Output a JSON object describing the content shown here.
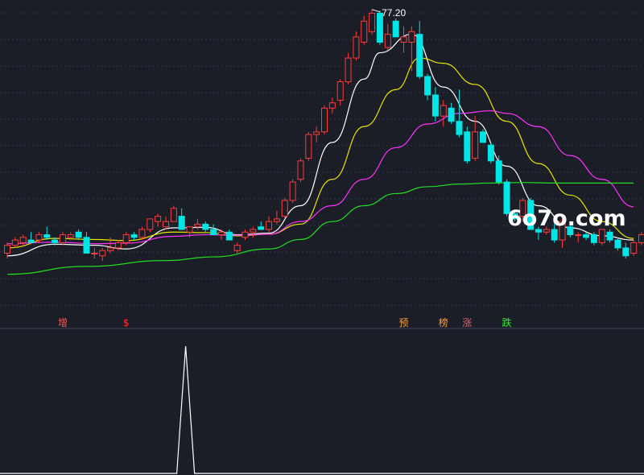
{
  "chart_data": {
    "type": "candlestick",
    "title": "",
    "xlabel": "",
    "ylabel": "",
    "ylim": [
      21,
      79
    ],
    "peak_label": "77.20",
    "watermark": "6o7o.com",
    "colors": {
      "up": "#ff3b3b",
      "down": "#00e5e5",
      "ma5": "#ffffff",
      "ma10": "#e6e600",
      "ma20": "#ff33ff",
      "ma60": "#22dd22",
      "grid": "#2a3552",
      "indicator": "#ffffff"
    },
    "candles": [
      [
        31.0,
        33.0,
        30.0,
        32.5
      ],
      [
        32.5,
        34.0,
        32.0,
        33.5
      ],
      [
        33.0,
        34.5,
        32.5,
        34.0
      ],
      [
        33.5,
        35.0,
        33.0,
        33.0
      ],
      [
        33.5,
        35.0,
        33.0,
        34.5
      ],
      [
        34.5,
        36.0,
        33.5,
        34.0
      ],
      [
        33.5,
        34.0,
        32.5,
        33.0
      ],
      [
        33.0,
        35.0,
        32.5,
        34.5
      ],
      [
        34.0,
        35.0,
        33.5,
        34.5
      ],
      [
        35.0,
        35.5,
        33.5,
        34.0
      ],
      [
        34.0,
        35.0,
        31.0,
        31.0
      ],
      [
        31.0,
        32.0,
        30.0,
        31.0
      ],
      [
        30.5,
        32.0,
        29.5,
        31.5
      ],
      [
        31.5,
        34.0,
        31.0,
        32.0
      ],
      [
        32.0,
        33.5,
        31.5,
        33.0
      ],
      [
        33.0,
        35.0,
        32.5,
        34.5
      ],
      [
        34.5,
        35.0,
        33.5,
        34.0
      ],
      [
        34.0,
        36.0,
        33.5,
        35.5
      ],
      [
        35.5,
        37.0,
        35.0,
        37.5
      ],
      [
        37.0,
        38.5,
        36.0,
        38.0
      ],
      [
        36.0,
        38.0,
        35.5,
        37.0
      ],
      [
        37.0,
        40.0,
        37.0,
        39.5
      ],
      [
        38.0,
        39.5,
        37.0,
        35.5
      ],
      [
        35.0,
        36.0,
        34.0,
        36.0
      ],
      [
        36.0,
        37.5,
        35.5,
        36.5
      ],
      [
        36.5,
        37.0,
        35.0,
        35.5
      ],
      [
        35.5,
        36.5,
        34.5,
        34.5
      ],
      [
        34.5,
        35.5,
        33.5,
        35.0
      ],
      [
        35.0,
        35.5,
        33.5,
        33.5
      ],
      [
        31.5,
        33.0,
        31.0,
        32.5
      ],
      [
        34.0,
        35.5,
        33.5,
        35.0
      ],
      [
        35.0,
        36.0,
        34.0,
        35.5
      ],
      [
        36.0,
        37.0,
        35.5,
        35.5
      ],
      [
        35.5,
        38.0,
        35.0,
        37.0
      ],
      [
        37.0,
        39.0,
        36.5,
        37.5
      ],
      [
        38.0,
        41.5,
        37.5,
        41.0
      ],
      [
        41.0,
        45.0,
        40.5,
        44.5
      ],
      [
        45.0,
        49.0,
        44.5,
        48.5
      ],
      [
        49.0,
        54.0,
        48.5,
        53.5
      ],
      [
        53.5,
        55.0,
        52.0,
        54.0
      ],
      [
        54.0,
        59.0,
        53.5,
        58.5
      ],
      [
        58.5,
        60.5,
        57.5,
        59.5
      ],
      [
        60.0,
        64.0,
        59.0,
        63.5
      ],
      [
        63.5,
        69.0,
        63.0,
        68.0
      ],
      [
        68.0,
        73.0,
        67.5,
        72.0
      ],
      [
        71.0,
        76.0,
        70.5,
        75.0
      ],
      [
        73.0,
        77.2,
        72.5,
        76.5
      ],
      [
        76.5,
        77.0,
        70.5,
        71.0
      ],
      [
        70.0,
        74.5,
        69.5,
        72.5
      ],
      [
        75.0,
        75.5,
        72.0,
        72.0
      ],
      [
        71.0,
        74.0,
        69.0,
        72.0
      ],
      [
        71.0,
        74.0,
        65.5,
        73.0
      ],
      [
        72.5,
        75.0,
        64.0,
        64.5
      ],
      [
        64.5,
        65.0,
        60.0,
        61.0
      ],
      [
        61.0,
        62.5,
        56.0,
        57.0
      ],
      [
        57.0,
        60.0,
        55.0,
        59.0
      ],
      [
        58.5,
        59.5,
        55.5,
        56.0
      ],
      [
        56.0,
        62.0,
        53.0,
        53.5
      ],
      [
        54.0,
        55.0,
        48.0,
        48.5
      ],
      [
        49.0,
        57.0,
        48.5,
        54.0
      ],
      [
        54.0,
        54.5,
        52.0,
        52.0
      ],
      [
        51.5,
        52.0,
        48.0,
        48.5
      ],
      [
        48.5,
        49.5,
        44.0,
        44.5
      ],
      [
        44.5,
        45.0,
        38.0,
        38.5
      ],
      [
        38.5,
        39.0,
        37.0,
        37.5
      ],
      [
        38.0,
        41.5,
        37.0,
        41.0
      ],
      [
        41.0,
        41.5,
        35.5,
        35.5
      ],
      [
        35.5,
        36.0,
        33.5,
        35.0
      ],
      [
        35.0,
        36.0,
        34.5,
        35.5
      ],
      [
        35.5,
        36.5,
        33.0,
        33.5
      ],
      [
        33.5,
        37.5,
        32.0,
        37.0
      ],
      [
        36.0,
        36.5,
        34.0,
        34.5
      ],
      [
        34.5,
        35.0,
        33.0,
        34.5
      ],
      [
        34.5,
        35.0,
        33.5,
        34.0
      ],
      [
        34.5,
        35.0,
        32.5,
        33.0
      ],
      [
        33.0,
        35.0,
        32.5,
        35.5
      ],
      [
        35.0,
        35.5,
        33.0,
        33.5
      ],
      [
        33.5,
        34.0,
        31.5,
        32.0
      ],
      [
        32.0,
        33.0,
        30.0,
        30.5
      ],
      [
        31.0,
        33.5,
        30.5,
        33.0
      ],
      [
        33.0,
        35.0,
        32.5,
        34.5
      ]
    ],
    "ma": [
      {
        "key": "ma5",
        "points": [
          [
            0,
            30.5
          ],
          [
            6,
            32.7
          ],
          [
            11,
            32.5
          ],
          [
            15,
            31.8
          ],
          [
            21,
            35.8
          ],
          [
            25,
            35.9
          ],
          [
            29,
            34.5
          ],
          [
            33,
            34.8
          ],
          [
            37,
            40
          ],
          [
            41,
            52
          ],
          [
            45,
            64
          ],
          [
            47,
            69
          ],
          [
            51,
            72.5
          ],
          [
            55,
            62.5
          ],
          [
            59,
            56
          ],
          [
            63,
            47.5
          ],
          [
            67,
            40
          ],
          [
            71,
            35.8
          ],
          [
            75,
            34.3
          ],
          [
            79,
            33.5
          ]
        ]
      },
      {
        "key": "ma10",
        "points": [
          [
            0,
            32.0
          ],
          [
            6,
            33.8
          ],
          [
            11,
            33.6
          ],
          [
            15,
            33.4
          ],
          [
            21,
            35.0
          ],
          [
            25,
            34.9
          ],
          [
            29,
            34.3
          ],
          [
            33,
            34.6
          ],
          [
            37,
            36.5
          ],
          [
            41,
            45
          ],
          [
            45,
            55
          ],
          [
            49,
            62
          ],
          [
            52,
            68
          ],
          [
            55,
            67
          ],
          [
            59,
            63
          ],
          [
            63,
            56
          ],
          [
            67,
            48
          ],
          [
            71,
            42
          ],
          [
            75,
            37
          ],
          [
            79,
            33.8
          ]
        ]
      },
      {
        "key": "ma20",
        "points": [
          [
            0,
            32.8
          ],
          [
            6,
            33.1
          ],
          [
            11,
            32.8
          ],
          [
            15,
            32.9
          ],
          [
            21,
            34.2
          ],
          [
            25,
            34.5
          ],
          [
            29,
            34.4
          ],
          [
            33,
            34.6
          ],
          [
            37,
            37
          ],
          [
            41,
            40
          ],
          [
            45,
            45
          ],
          [
            49,
            51
          ],
          [
            53,
            55.5
          ],
          [
            57,
            57.5
          ],
          [
            61,
            58
          ],
          [
            63,
            57.5
          ],
          [
            67,
            55
          ],
          [
            71,
            49.5
          ],
          [
            75,
            45
          ],
          [
            79,
            39.8
          ]
        ]
      },
      {
        "key": "ma60",
        "points": [
          [
            0,
            27.0
          ],
          [
            10,
            28.5
          ],
          [
            20,
            29.6
          ],
          [
            26,
            30.3
          ],
          [
            33,
            31.8
          ],
          [
            37,
            33.6
          ],
          [
            41,
            37
          ],
          [
            45,
            40
          ],
          [
            49,
            42.3
          ],
          [
            53,
            43.6
          ],
          [
            57,
            44.1
          ],
          [
            61,
            44.3
          ],
          [
            65,
            44.4
          ],
          [
            69,
            44.3
          ],
          [
            75,
            44.3
          ],
          [
            79,
            44.3
          ]
        ]
      }
    ],
    "signals": [
      {
        "index": 7,
        "label": "增",
        "color": "#ff5555"
      },
      {
        "index": 15,
        "label": "$",
        "color": "#ff3333"
      },
      {
        "index": 50,
        "label": "预",
        "color": "#ff9a33"
      },
      {
        "index": 55,
        "label": "榜",
        "color": "#ff9a33"
      },
      {
        "index": 58,
        "label": "涨",
        "color": "#ff5555"
      },
      {
        "index": 63,
        "label": "跌",
        "color": "#33ee33"
      }
    ],
    "indicator": {
      "type": "line",
      "ylim": [
        0,
        1
      ],
      "values": [
        0,
        0,
        0,
        0,
        0,
        0,
        0,
        0,
        0,
        0,
        0,
        0,
        0,
        0,
        0,
        0,
        0,
        0,
        0,
        0,
        0,
        0,
        1,
        0,
        0,
        0,
        0,
        0,
        0,
        0,
        0,
        0,
        0,
        0,
        0,
        0,
        0,
        0,
        0,
        0,
        0,
        0,
        0,
        0,
        0,
        0,
        0,
        0,
        0,
        0,
        0,
        0,
        0,
        0,
        0,
        0,
        0,
        0,
        0,
        0,
        0,
        0,
        0,
        0,
        0,
        0,
        0,
        0,
        0,
        0,
        0,
        0,
        0,
        0,
        0,
        0,
        0,
        0,
        0,
        0,
        0
      ]
    }
  }
}
